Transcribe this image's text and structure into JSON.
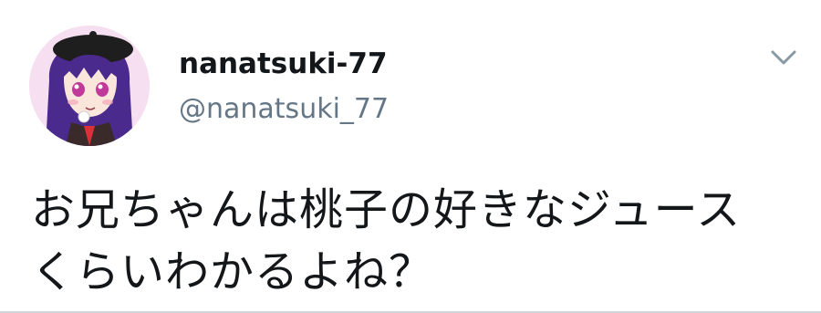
{
  "tweet": {
    "display_name": "nanatsuki-77",
    "handle": "@nanatsuki_77",
    "text_lines": [
      "お兄ちゃんは桃子の好きなジュース",
      "くらいわかるよね？"
    ],
    "avatar_icon": "anime-girl-avatar-icon",
    "menu_icon": "chevron-down-icon"
  },
  "colors": {
    "name": "#14171a",
    "handle": "#657786",
    "chevron": "#8899a6",
    "avatar_bg": "#f6dff0",
    "hair": "#4a2a8c"
  }
}
